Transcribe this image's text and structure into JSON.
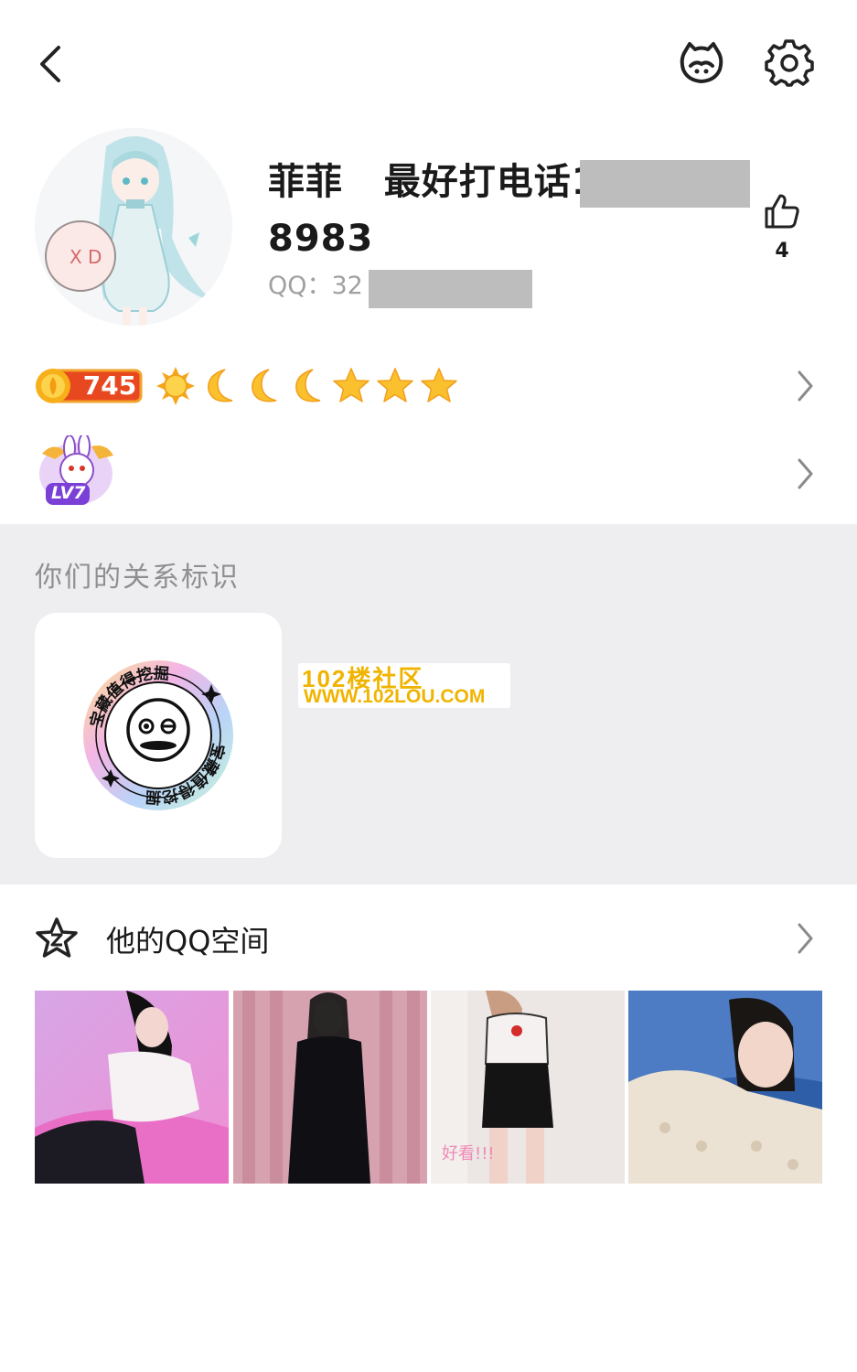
{
  "header": {
    "back_icon": "chevron-left-icon",
    "pet_icon": "pet-cat-icon",
    "settings_icon": "gear-icon"
  },
  "profile": {
    "nickname": "菲菲   最好打电话15",
    "nickname_line2": "8983",
    "qq_label": "QQ：32",
    "likes": "4"
  },
  "level": {
    "coins": "745",
    "icons": [
      "sun-icon",
      "moon-icon",
      "moon-icon",
      "moon-icon",
      "star-icon",
      "star-icon",
      "star-icon"
    ]
  },
  "badge": {
    "text": "LV7"
  },
  "relation": {
    "title": "你们的关系标识",
    "badge_text": "宝藏值得挖掘"
  },
  "watermark": {
    "line1": "102楼社区",
    "line2": "WWW.102LOU.COM"
  },
  "qzone": {
    "title": "他的QQ空间",
    "photo_caption": "好看!!!"
  },
  "colors": {
    "accent_gold": "#f7c21c",
    "section_gray": "#eeeef0",
    "redaction": "#bdbdbd"
  }
}
